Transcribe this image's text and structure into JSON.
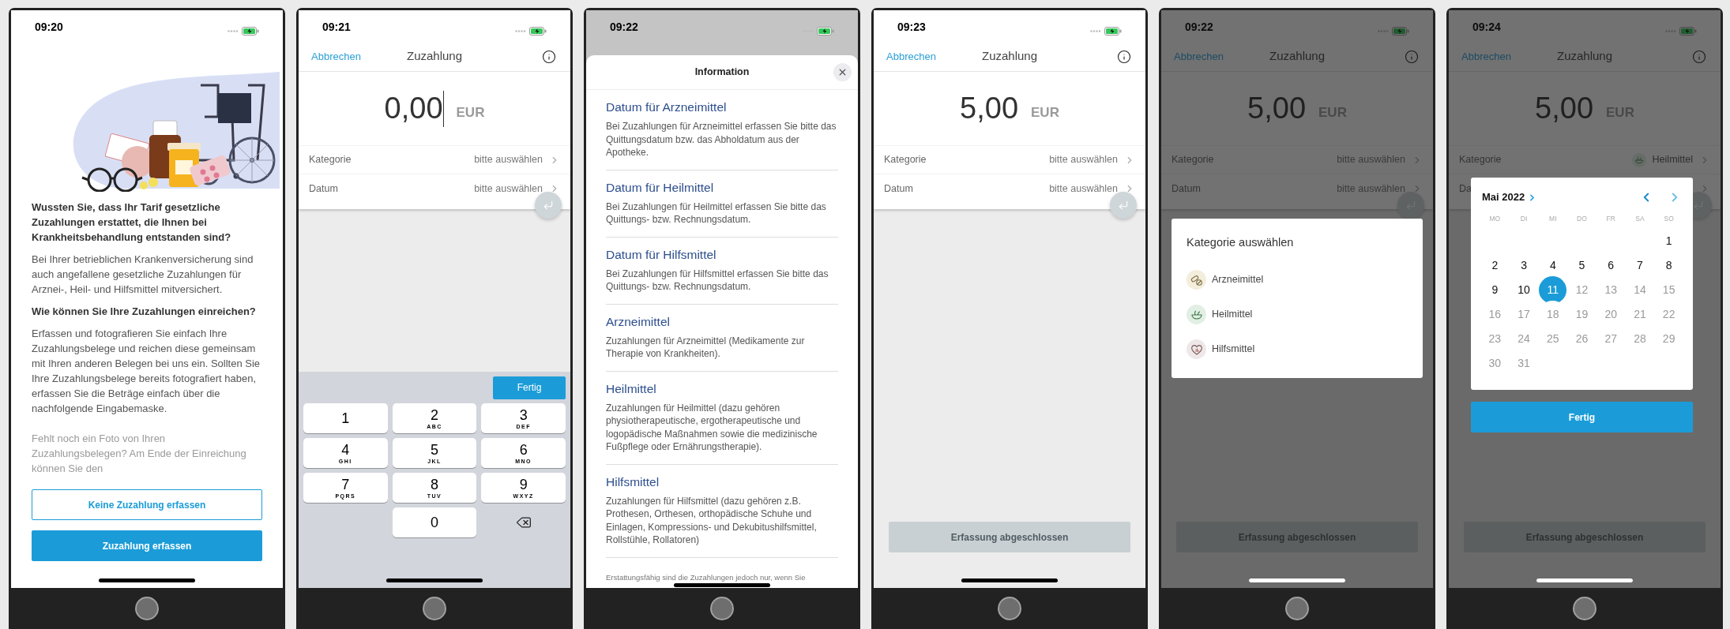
{
  "phones": [
    {
      "kind": "intro",
      "time": "09:20",
      "paragraphs": [
        {
          "kind": "bold",
          "text": "Wussten Sie, dass Ihr Tarif gesetzliche Zuzahlungen erstattet, die Ihnen bei Krankheitsbehandlung entstanden sind?"
        },
        {
          "kind": "body",
          "text": "Bei Ihrer betrieblichen Krankenversicherung sind auch angefallene gesetzliche Zuzahlungen für Arznei-, Heil- und Hilfsmittel mitversichert."
        },
        {
          "kind": "bold",
          "text": "Wie können Sie Ihre Zuzahlungen einreichen?"
        },
        {
          "kind": "body",
          "text": "Erfassen und fotografieren Sie einfach Ihre Zuzahlungsbelege und reichen diese gemeinsam mit Ihren anderen Belegen bei uns ein. Sollten Sie Ihre Zuzahlungsbelege bereits fotografiert haben, erfassen Sie die Beträge einfach über die nachfolgende Eingabemaske."
        },
        {
          "kind": "faded",
          "text": "Fehlt noch ein Foto von Ihren Zuzahlungsbelegen? Am Ende der Einreichung können Sie den"
        }
      ],
      "buttons": [
        {
          "kind": "outline",
          "label": "Keine Zuzahlung erfassen"
        },
        {
          "kind": "filled",
          "label": "Zuzahlung erfassen"
        }
      ]
    },
    {
      "kind": "form",
      "time": "09:21",
      "cancel": "Abbrechen",
      "title": "Zuzahlung",
      "amount": "0,00",
      "currency": "EUR",
      "focused": true,
      "rows": [
        {
          "kind": "placeholder",
          "label": "Kategorie",
          "value": "bitte auswählen"
        },
        {
          "kind": "placeholder",
          "label": "Datum",
          "value": "bitte auswählen"
        }
      ],
      "keyboard": {
        "done": "Fertig",
        "keys": [
          {
            "digit": "1"
          },
          {
            "digit": "2",
            "letters": "ABC"
          },
          {
            "digit": "3",
            "letters": "DEF"
          },
          {
            "digit": "4",
            "letters": "GHI"
          },
          {
            "digit": "5",
            "letters": "JKL"
          },
          {
            "digit": "6",
            "letters": "MNO"
          },
          {
            "digit": "7",
            "letters": "PQRS"
          },
          {
            "digit": "8",
            "letters": "TUV"
          },
          {
            "digit": "9",
            "letters": "WXYZ"
          },
          {
            "digit": "0"
          }
        ]
      }
    },
    {
      "kind": "info",
      "time": "09:22",
      "title": "Information",
      "sections": [
        {
          "heading": "Datum für Arzneimittel",
          "text": "Bei Zuzahlungen für Arzneimittel erfassen Sie bitte das Quittungsdatum bzw. das Abholdatum aus der Apotheke."
        },
        {
          "heading": "Datum für Heilmittel",
          "text": "Bei Zuzahlungen für Heilmittel erfassen Sie bitte das Quittungs- bzw. Rechnungsdatum."
        },
        {
          "heading": "Datum für Hilfsmittel",
          "text": "Bei Zuzahlungen für Hilfsmittel erfassen Sie bitte das Quittungs- bzw. Rechnungsdatum."
        },
        {
          "heading": "Arzneimittel",
          "text": "Zuzahlungen für Arzneimittel (Medikamente zur Therapie von Krankheiten)."
        },
        {
          "heading": "Heilmittel",
          "text": "Zuzahlungen für Heilmittel (dazu gehören physiotherapeutische, ergotherapeutische und logopädische Maßnahmen sowie die medizinische Fußpflege oder Ernährungstherapie)."
        },
        {
          "heading": "Hilfsmittel",
          "text": "Zuzahlungen für Hilfsmittel (dazu gehören z.B. Prothesen, Orthesen, orthopädische Schuhe und Einlagen, Kompressions- und Dekubitushilfsmittel, Rollstühle, Rollatoren)"
        }
      ],
      "footer": "Erstattungsfähig sind die Zuzahlungen jedoch nur, wenn Sie"
    },
    {
      "kind": "form",
      "time": "09:23",
      "cancel": "Abbrechen",
      "title": "Zuzahlung",
      "amount": "5,00",
      "currency": "EUR",
      "rows": [
        {
          "kind": "placeholder",
          "label": "Kategorie",
          "value": "bitte auswählen"
        },
        {
          "kind": "placeholder",
          "label": "Datum",
          "value": "bitte auswählen"
        }
      ],
      "submit": {
        "label": "Erfassung abgeschlossen",
        "disabled": true
      }
    },
    {
      "kind": "form",
      "time": "09:22",
      "cancel": "Abbrechen",
      "title": "Zuzahlung",
      "amount": "5,00",
      "currency": "EUR",
      "dimmed": true,
      "rows": [
        {
          "kind": "placeholder",
          "label": "Kategorie",
          "value": "bitte auswählen"
        },
        {
          "kind": "placeholder",
          "label": "Datum",
          "value": "bitte auswählen"
        }
      ],
      "submit": {
        "label": "Erfassung abgeschlossen",
        "disabled": true
      },
      "dialog": {
        "title": "Kategorie auswählen",
        "options": [
          {
            "label": "Arzneimittel",
            "color": "#f3eddc"
          },
          {
            "label": "Heilmittel",
            "color": "#e2efe4"
          },
          {
            "label": "Hilfsmittel",
            "color": "#efe8e8"
          }
        ]
      }
    },
    {
      "kind": "form",
      "time": "09:24",
      "cancel": "Abbrechen",
      "title": "Zuzahlung",
      "amount": "5,00",
      "currency": "EUR",
      "dimmed": true,
      "rows": [
        {
          "kind": "choice",
          "label": "Kategorie",
          "value": "Heilmittel"
        },
        {
          "kind": "placeholder",
          "label": "Da"
        }
      ],
      "submit": {
        "label": "Erfassung abgeschlossen",
        "disabled": true
      },
      "calendar": {
        "month": "Mai 2022",
        "weekdays": [
          "MO",
          "DI",
          "MI",
          "DO",
          "FR",
          "SA",
          "SO"
        ],
        "done": "Fertig",
        "days": [
          {
            "day": "1",
            "selected": false,
            "disabled": false
          },
          {
            "day": "2",
            "selected": false,
            "disabled": false
          },
          {
            "day": "3",
            "selected": false,
            "disabled": false
          },
          {
            "day": "4",
            "selected": false,
            "disabled": false
          },
          {
            "day": "5",
            "selected": false,
            "disabled": false
          },
          {
            "day": "6",
            "selected": false,
            "disabled": false
          },
          {
            "day": "7",
            "selected": false,
            "disabled": false
          },
          {
            "day": "8",
            "selected": false,
            "disabled": false
          },
          {
            "day": "9",
            "selected": false,
            "disabled": false
          },
          {
            "day": "10",
            "selected": false,
            "disabled": false
          },
          {
            "day": "11",
            "selected": true,
            "disabled": false
          },
          {
            "day": "12",
            "selected": false,
            "disabled": true
          },
          {
            "day": "13",
            "selected": false,
            "disabled": true
          },
          {
            "day": "14",
            "selected": false,
            "disabled": true
          },
          {
            "day": "15",
            "selected": false,
            "disabled": true
          },
          {
            "day": "16",
            "selected": false,
            "disabled": true
          },
          {
            "day": "17",
            "selected": false,
            "disabled": true
          },
          {
            "day": "18",
            "selected": false,
            "disabled": true
          },
          {
            "day": "19",
            "selected": false,
            "disabled": true
          },
          {
            "day": "20",
            "selected": false,
            "disabled": true
          },
          {
            "day": "21",
            "selected": false,
            "disabled": true
          },
          {
            "day": "22",
            "selected": false,
            "disabled": true
          },
          {
            "day": "23",
            "selected": false,
            "disabled": true
          },
          {
            "day": "24",
            "selected": false,
            "disabled": true
          },
          {
            "day": "25",
            "selected": false,
            "disabled": true
          },
          {
            "day": "26",
            "selected": false,
            "disabled": true
          },
          {
            "day": "27",
            "selected": false,
            "disabled": true
          },
          {
            "day": "28",
            "selected": false,
            "disabled": true
          },
          {
            "day": "29",
            "selected": false,
            "disabled": true
          },
          {
            "day": "30",
            "selected": false,
            "disabled": true
          },
          {
            "day": "31",
            "selected": false,
            "disabled": true
          }
        ]
      }
    }
  ]
}
